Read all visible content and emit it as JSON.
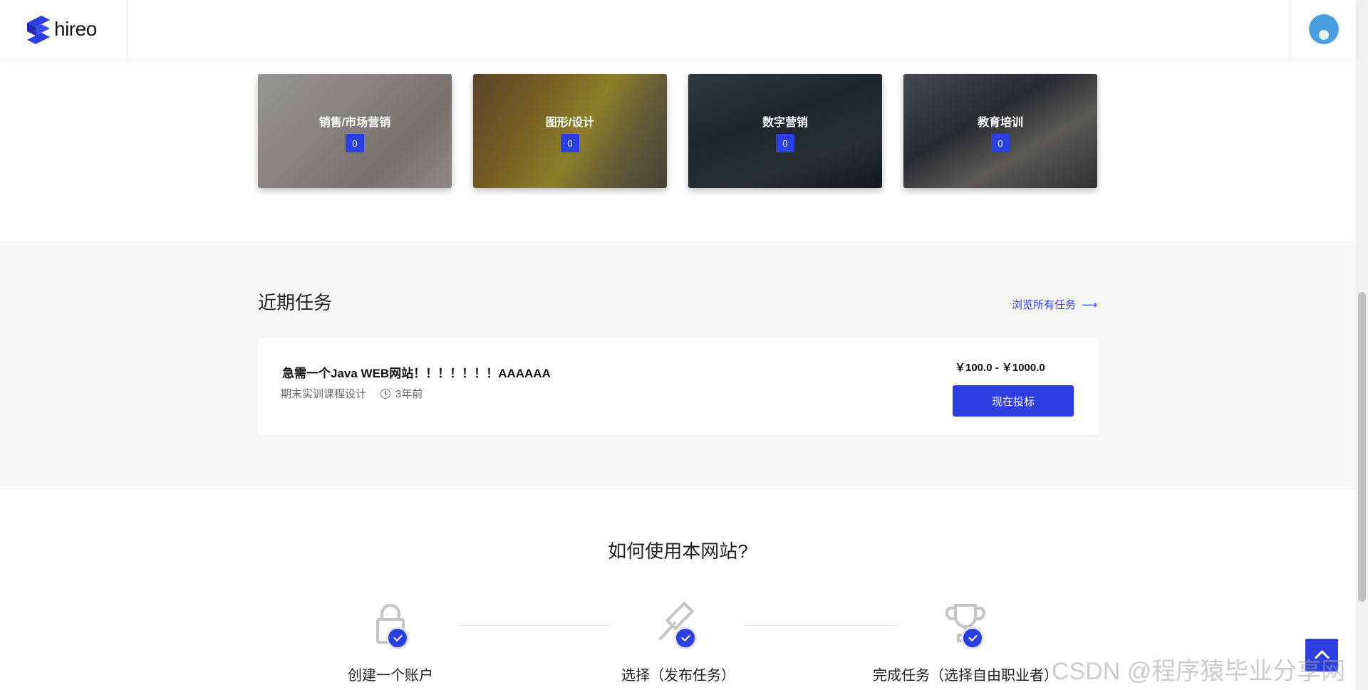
{
  "header": {
    "logo_text": "hireo",
    "logo_icon": "hireo-logo-icon",
    "avatar_icon": "user-avatar-icon"
  },
  "categories": [
    {
      "title": "销售/市场营销",
      "count": "0"
    },
    {
      "title": "图形/设计",
      "count": "0"
    },
    {
      "title": "数字营销",
      "count": "0"
    },
    {
      "title": "教育培训",
      "count": "0"
    }
  ],
  "recent": {
    "title": "近期任务",
    "browse_label": "浏览所有任务",
    "browse_icon": "arrow-right-icon",
    "task": {
      "title": "急需一个Java WEB网站！！！！！！！AAAAAA",
      "category": "期末实训课程设计",
      "time": "3年前",
      "price": "￥100.0 - ￥1000.0",
      "bid_label": "现在投标"
    }
  },
  "how": {
    "title": "如何使用本网站?",
    "steps": [
      {
        "label": "创建一个账户",
        "icon": "lock-icon"
      },
      {
        "label": "选择（发布任务）",
        "icon": "gavel-icon"
      },
      {
        "label": "完成任务（选择自由职业者）",
        "icon": "trophy-icon"
      }
    ]
  },
  "watermark": "CSDN @程序猿毕业分享网",
  "colors": {
    "accent": "#2d3fe0",
    "section_bg": "#f7f7f7"
  }
}
